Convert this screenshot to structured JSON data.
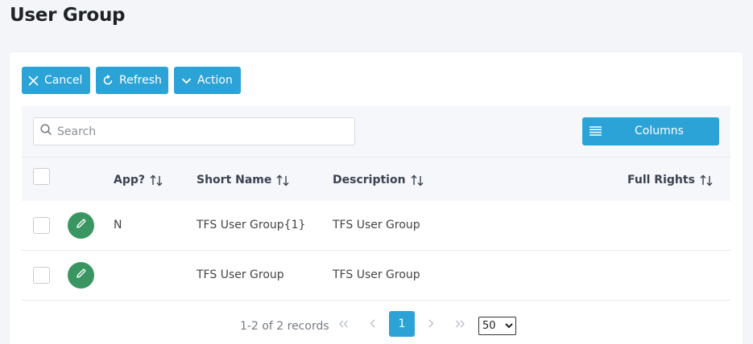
{
  "page": {
    "title": "User Group"
  },
  "toolbar": {
    "cancel_label": "Cancel",
    "refresh_label": "Refresh",
    "action_label": "Action"
  },
  "grid": {
    "search_placeholder": "Search",
    "columns_label": "Columns",
    "headers": {
      "app": "App?",
      "short_name": "Short Name",
      "description": "Description",
      "full_rights": "Full Rights"
    },
    "rows": [
      {
        "app": "N",
        "short_name": "TFS User Group{1}",
        "description": "TFS User Group",
        "full_rights": ""
      },
      {
        "app": "",
        "short_name": "TFS User Group",
        "description": "TFS User Group",
        "full_rights": ""
      }
    ]
  },
  "pager": {
    "info": "1-2 of 2 records",
    "current_page": "1",
    "page_size": "50",
    "page_size_options": [
      "50"
    ]
  },
  "colors": {
    "accent": "#2ba3d6",
    "edit": "#3a9660",
    "background": "#f3f5f8"
  }
}
